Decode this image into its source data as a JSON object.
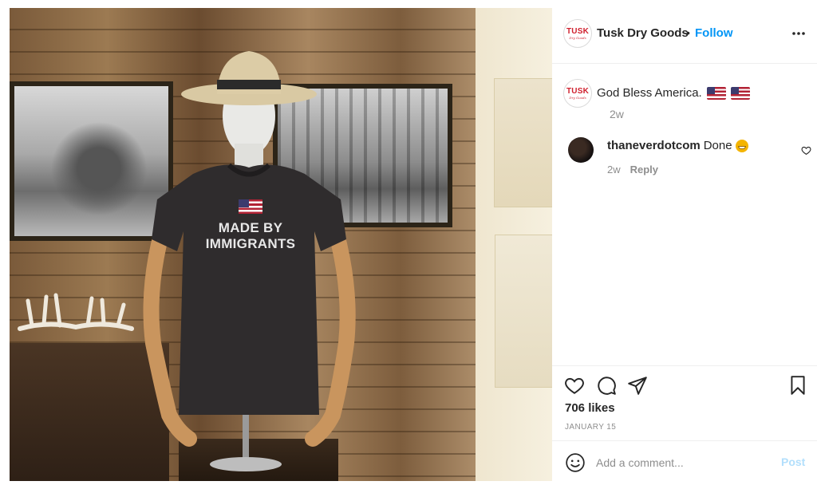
{
  "post": {
    "image_print": {
      "line1": "MADE BY",
      "line2": "IMMIGRANTS"
    }
  },
  "header": {
    "account_name": "Tusk Dry Goods",
    "separator": "•",
    "follow_label": "Follow",
    "avatar_text": "TUSK",
    "avatar_subtext": "Dry Goods"
  },
  "caption": {
    "text": "God Bless America.",
    "time": "2w"
  },
  "comments": [
    {
      "username": "thaneverdotcom",
      "text": "Done",
      "time": "2w",
      "reply_label": "Reply"
    }
  ],
  "actions": {
    "likes": "706 likes",
    "date": "JANUARY 15"
  },
  "composer": {
    "placeholder": "Add a comment...",
    "post_label": "Post"
  },
  "colors": {
    "accent": "#0095f6",
    "post_disabled": "#b2dffc",
    "brand_red": "#d0202e"
  }
}
